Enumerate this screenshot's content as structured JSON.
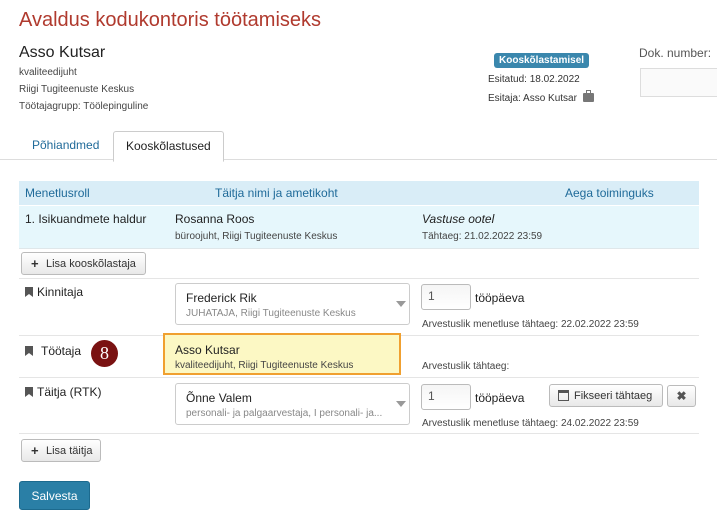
{
  "page": {
    "title": "Avaldus kodukontoris töötamiseks"
  },
  "user": {
    "name": "Asso Kutsar",
    "position": "kvaliteedijuht",
    "org": "Riigi Tugiteenuste Keskus",
    "group": "Töötajagrupp: Töölepinguline"
  },
  "status": {
    "badge": "Kooskõlastamisel",
    "submitted": "Esitatud: 18.02.2022",
    "submitter": "Esitaja: Asso Kutsar"
  },
  "doc": {
    "label": "Dok. number:"
  },
  "tabs": [
    {
      "label": "Põhiandmed"
    },
    {
      "label": "Kooskõlastused"
    }
  ],
  "table": {
    "headers": [
      "Menetlusroll",
      "Täitja nimi ja ametikoht",
      "Aega toiminguks"
    ],
    "row1": {
      "role": "1. Isikuandmete haldur",
      "name": "Rosanna Roos",
      "title": "büroojuht, Riigi Tugiteenuste Keskus",
      "status": "Vastuse ootel",
      "deadline": "Tähtaeg: 21.02.2022 23:59"
    },
    "add_approver": "Lisa kooskõlastaja",
    "kinnitaja": {
      "role": "Kinnitaja",
      "name": "Frederick Rik",
      "title": "JUHATAJA, Riigi Tugiteenuste Keskus",
      "days": "1",
      "unit": "tööpäeva",
      "deadline": "Arvestuslik menetluse tähtaeg: 22.02.2022 23:59"
    },
    "tootaja": {
      "role": "Töötaja",
      "badge": "8",
      "name": "Asso Kutsar",
      "title": "kvaliteedijuht, Riigi Tugiteenuste Keskus",
      "deadline": "Arvestuslik tähtaeg:"
    },
    "taitja": {
      "role": "Täitja (RTK)",
      "name": "Õnne Valem",
      "title": "personali- ja palgaarvestaja, I personali- ja...",
      "days": "1",
      "unit": "tööpäeva",
      "fix_label": "Fikseeri tähtaeg",
      "deadline": "Arvestuslik menetluse tähtaeg: 24.02.2022 23:59"
    },
    "add_executor": "Lisa täitja"
  },
  "actions": {
    "save": "Salvesta"
  },
  "colors": {
    "title": "#b03a2e",
    "accent": "#2a7fa6",
    "header_bg": "#d9edf7",
    "highlight_bg": "#fcf8c4",
    "highlight_border": "#f0a030",
    "badge": "#7a1212"
  }
}
